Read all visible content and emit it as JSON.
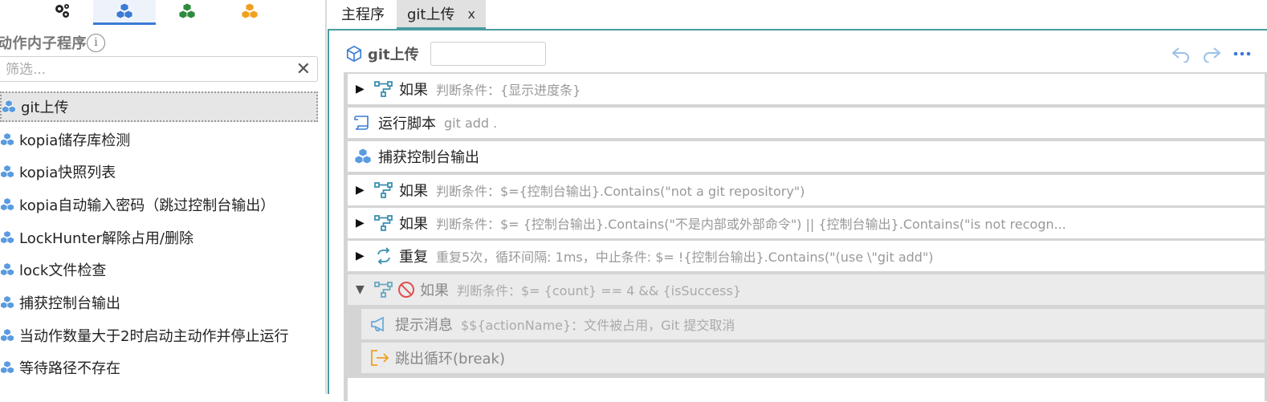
{
  "left_panel": {
    "section_title": "动作内子程序",
    "info_glyph": "i",
    "filter": {
      "placeholder": "筛选...",
      "value": ""
    },
    "clear_glyph": "✕",
    "items": [
      {
        "label": "git上传",
        "selected": true
      },
      {
        "label": "kopia储存库检测"
      },
      {
        "label": "kopia快照列表"
      },
      {
        "label": "kopia自动输入密码（跳过控制台输出）"
      },
      {
        "label": "LockHunter解除占用/删除"
      },
      {
        "label": "lock文件检查"
      },
      {
        "label": "捕获控制台输出"
      },
      {
        "label": "当动作数量大于2时启动主动作并停止运行"
      },
      {
        "label": "等待路径不存在"
      }
    ],
    "icon_tabs": [
      {
        "icon": "gears-icon",
        "color": "#222222"
      },
      {
        "icon": "cubes-blue-icon",
        "color": "#3a7bd5",
        "active": true
      },
      {
        "icon": "cubes-green-icon",
        "color": "#2e8b3e"
      },
      {
        "icon": "cubes-orange-icon",
        "color": "#f0a020"
      }
    ]
  },
  "tabs": [
    {
      "label": "主程序"
    },
    {
      "label": "git上传",
      "close": "x",
      "active": true
    }
  ],
  "editor": {
    "title": "git上传",
    "name_input": "",
    "accent": "#4a9ba0"
  },
  "steps": [
    {
      "name": "如果",
      "desc": "判断条件：{显示进度条}",
      "icon": "branch-icon",
      "expand": "▶"
    },
    {
      "name": "运行脚本",
      "desc": "git add .",
      "icon": "script-icon"
    },
    {
      "name": "捕获控制台输出",
      "desc": "",
      "icon": "cubes-icon"
    },
    {
      "name": "如果",
      "desc": "判断条件：$={控制台输出}.Contains(\"not a git repository\")",
      "icon": "branch-icon",
      "expand": "▶"
    },
    {
      "name": "如果",
      "desc": "判断条件：$= {控制台输出}.Contains(\"不是内部或外部命令\") || {控制台输出}.Contains(\"is not recogn...",
      "icon": "branch-icon",
      "expand": "▶"
    },
    {
      "name": "重复",
      "desc": "重复5次，循环间隔: 1ms，中止条件: $= !{控制台输出}.Contains(\"(use \\\"git add\")",
      "icon": "loop-icon",
      "expand": "▶"
    },
    {
      "name": "如果",
      "desc": "判断条件：$= {count} == 4 && {isSuccess}",
      "icon": "branch-icon",
      "expand": "▼",
      "disabled": true
    },
    {
      "name": "提示消息",
      "desc": "$${actionName}：文件被占用，Git 提交取消",
      "icon": "megaphone-icon",
      "nested": true,
      "disabled": true
    },
    {
      "name": "跳出循环(break)",
      "desc": "",
      "icon": "exit-icon",
      "nested": true,
      "disabled": true
    }
  ]
}
